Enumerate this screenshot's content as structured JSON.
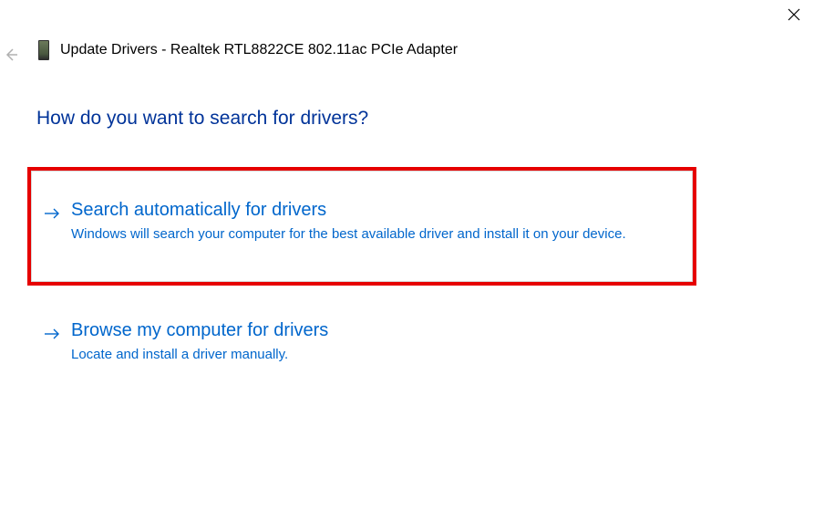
{
  "window": {
    "title": "Update Drivers - Realtek RTL8822CE 802.11ac PCIe Adapter"
  },
  "heading": "How do you want to search for drivers?",
  "options": {
    "auto": {
      "title": "Search automatically for drivers",
      "desc": "Windows will search your computer for the best available driver and install it on your device."
    },
    "browse": {
      "title": "Browse my computer for drivers",
      "desc": "Locate and install a driver manually."
    }
  }
}
